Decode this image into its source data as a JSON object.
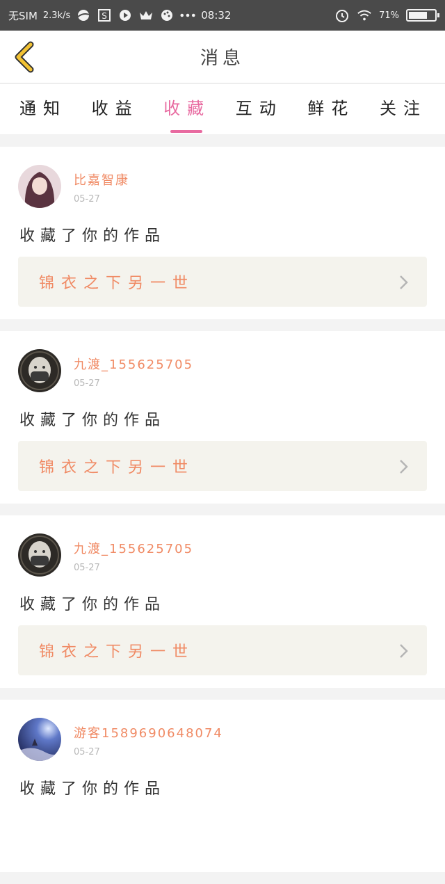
{
  "status_bar": {
    "carrier": "无SIM",
    "speed": "2.3k/s",
    "time": "08:32",
    "battery_text": "71%",
    "battery_level": 0.71,
    "icons": [
      "planet-icon",
      "s-app-icon",
      "play-icon",
      "crown-icon",
      "palette-icon",
      "more-dots-icon",
      "alarm-icon",
      "wifi-icon",
      "battery-icon"
    ]
  },
  "header": {
    "title": "消息",
    "back_icon": "chevron-left-icon",
    "accent": "#f2c233"
  },
  "tabs": [
    {
      "label": "通知",
      "active": false
    },
    {
      "label": "收益",
      "active": false
    },
    {
      "label": "收藏",
      "active": true
    },
    {
      "label": "互动",
      "active": false
    },
    {
      "label": "鲜花",
      "active": false
    },
    {
      "label": "关注",
      "active": false
    }
  ],
  "colors": {
    "tab_active": "#e86aa0",
    "name": "#f08a64",
    "work_bg": "#f4f3ed"
  },
  "items": [
    {
      "name": "比嘉智康",
      "date": "05-27",
      "action": "收藏了你的作品",
      "work": "锦衣之下另一世",
      "avatar": "avatar-anime-girl"
    },
    {
      "name": "九渡_155625705",
      "date": "05-27",
      "action": "收藏了你的作品",
      "work": "锦衣之下另一世",
      "avatar": "avatar-masked-girl"
    },
    {
      "name": "九渡_155625705",
      "date": "05-27",
      "action": "收藏了你的作品",
      "work": "锦衣之下另一世",
      "avatar": "avatar-masked-girl"
    },
    {
      "name": "游客1589690648074",
      "date": "05-27",
      "action": "收藏了你的作品",
      "work": "",
      "avatar": "avatar-night-sky"
    }
  ]
}
